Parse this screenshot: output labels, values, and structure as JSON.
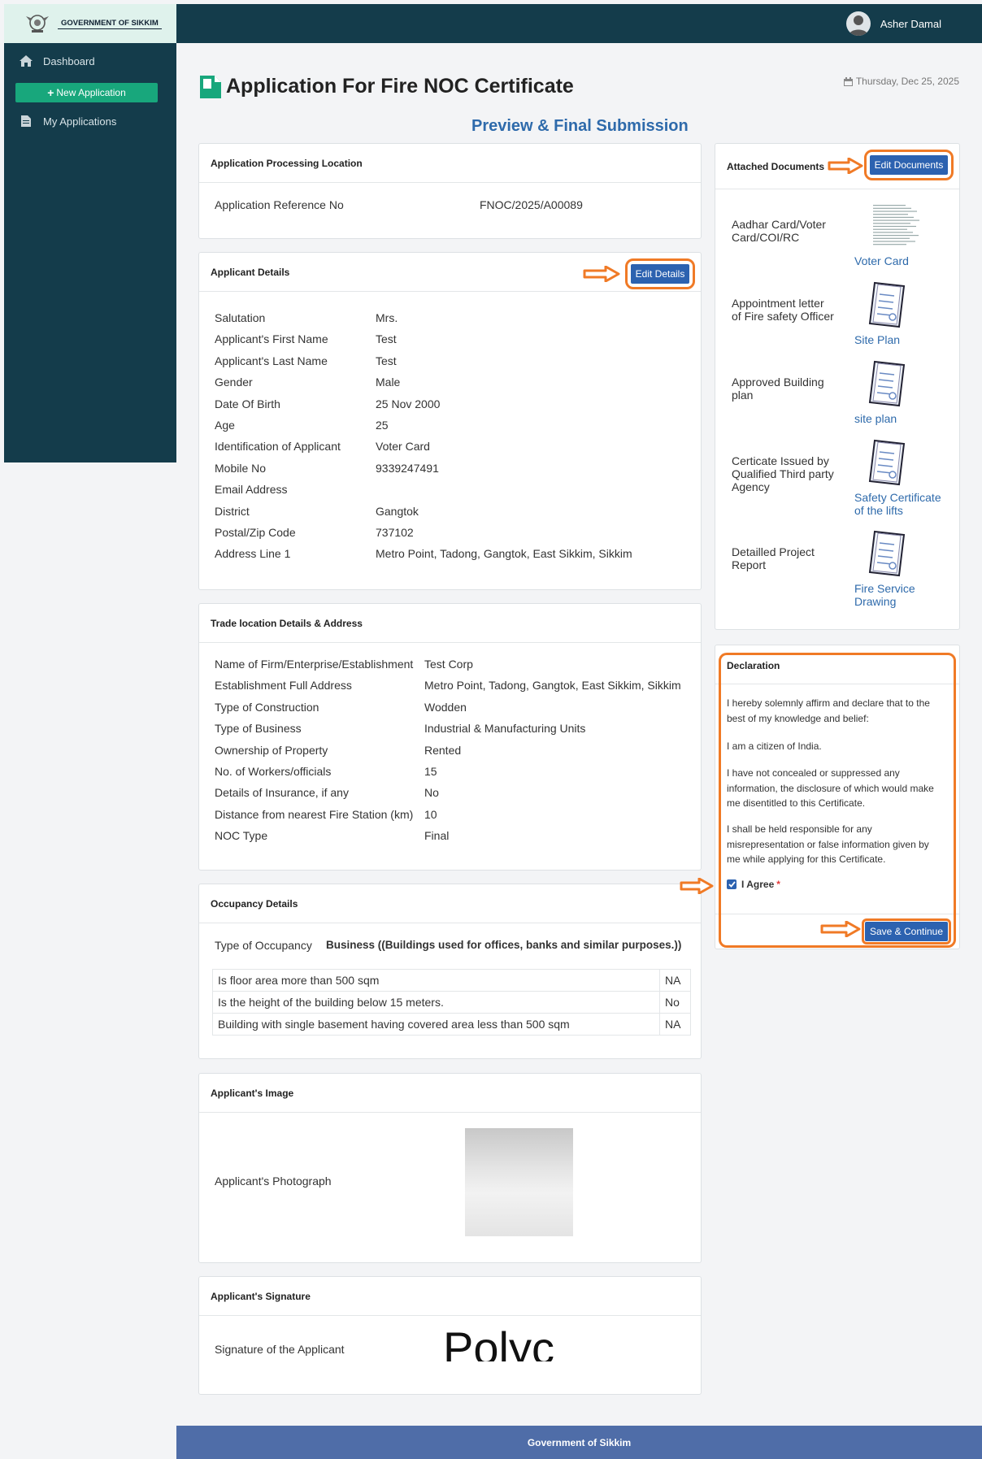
{
  "app": {
    "logo_text": "GOVERNMENT OF SIKKIM",
    "user_name": "Asher Damal",
    "date": "Thursday, Dec 25, 2025"
  },
  "nav": {
    "dashboard": "Dashboard",
    "new_application": "New Application",
    "my_applications": "My Applications"
  },
  "page": {
    "title": "Application For Fire NOC Certificate",
    "subtitle": "Preview & Final Submission"
  },
  "processing": {
    "title": "Application Processing Location",
    "ref_label": "Application Reference No",
    "ref_value": "FNOC/2025/A00089"
  },
  "applicant": {
    "title": "Applicant Details",
    "edit_label": "Edit Details",
    "rows": [
      {
        "label": "Salutation",
        "value": "Mrs."
      },
      {
        "label": "Applicant's First Name",
        "value": "Test"
      },
      {
        "label": "Applicant's Last Name",
        "value": "Test"
      },
      {
        "label": "Gender",
        "value": "Male"
      },
      {
        "label": "Date Of Birth",
        "value": "25 Nov 2000"
      },
      {
        "label": "Age",
        "value": "25"
      },
      {
        "label": "Identification of Applicant",
        "value": "Voter Card"
      },
      {
        "label": "Mobile No",
        "value": "9339247491"
      },
      {
        "label": "Email Address",
        "value": ""
      },
      {
        "label": "District",
        "value": "Gangtok"
      },
      {
        "label": "Postal/Zip Code",
        "value": "737102"
      },
      {
        "label": "Address Line 1",
        "value": "Metro Point, Tadong, Gangtok, East Sikkim, Sikkim"
      }
    ]
  },
  "trade": {
    "title": "Trade location Details & Address",
    "rows": [
      {
        "label": "Name of Firm/Enterprise/Establishment",
        "value": "Test Corp"
      },
      {
        "label": "Establishment Full Address",
        "value": "Metro Point, Tadong, Gangtok, East Sikkim, Sikkim"
      },
      {
        "label": "Type of Construction",
        "value": "Wodden"
      },
      {
        "label": "Type of Business",
        "value": "Industrial & Manufacturing Units"
      },
      {
        "label": "Ownership of Property",
        "value": "Rented"
      },
      {
        "label": "No. of Workers/officials",
        "value": "15"
      },
      {
        "label": "Details of Insurance, if any",
        "value": "No"
      },
      {
        "label": "Distance from nearest Fire Station (km)",
        "value": "10"
      },
      {
        "label": "NOC Type",
        "value": "Final"
      }
    ]
  },
  "occupancy": {
    "title": "Occupancy Details",
    "type_label": "Type of Occupancy",
    "type_value": "Business ((Buildings used for offices, banks and similar purposes.))",
    "rows": [
      {
        "label": "Is floor area more than 500 sqm",
        "value": "NA"
      },
      {
        "label": "Is the height of the building below 15 meters.",
        "value": "No"
      },
      {
        "label": "Building with single basement having covered area less than 500 sqm",
        "value": "NA"
      }
    ]
  },
  "image": {
    "title": "Applicant's Image",
    "label": "Applicant's Photograph"
  },
  "signature": {
    "title": "Applicant's Signature",
    "label": "Signature of the Applicant",
    "sig_text": "Polyc"
  },
  "documents": {
    "title": "Attached Documents",
    "edit_label": "Edit Documents",
    "items": [
      {
        "label": "Aadhar Card/Voter Card/COI/RC",
        "link": "Voter Card"
      },
      {
        "label": "Appointment letter of Fire safety Officer",
        "link": "Site Plan"
      },
      {
        "label": "Approved Building plan",
        "link": "site plan"
      },
      {
        "label": "Certicate Issued by Qualified Third party Agency",
        "link": "Safety Certificate of the lifts"
      },
      {
        "label": "Detailled Project Report",
        "link": "Fire Service Drawing"
      }
    ]
  },
  "declaration": {
    "title": "Declaration",
    "para1": "I hereby solemnly affirm and declare that to the best of my knowledge and belief:",
    "para2": "I am a citizen of India.",
    "para3": "I have not concealed or suppressed any information, the disclosure of which would make me disentitled to this Certificate.",
    "para4": "I shall be held responsible for any misrepresentation or false information given by me while applying for this Certificate.",
    "agree_label": "I Agree",
    "required_mark": "*",
    "agree_checked": true,
    "submit_label": "Save & Continue"
  },
  "footer": {
    "text": "Government of Sikkim"
  },
  "colors": {
    "sidebar": "#143c4b",
    "accent_green": "#18a77c",
    "button_blue": "#2c62b0",
    "highlight": "#f07a26",
    "footer": "#4f6da8"
  }
}
